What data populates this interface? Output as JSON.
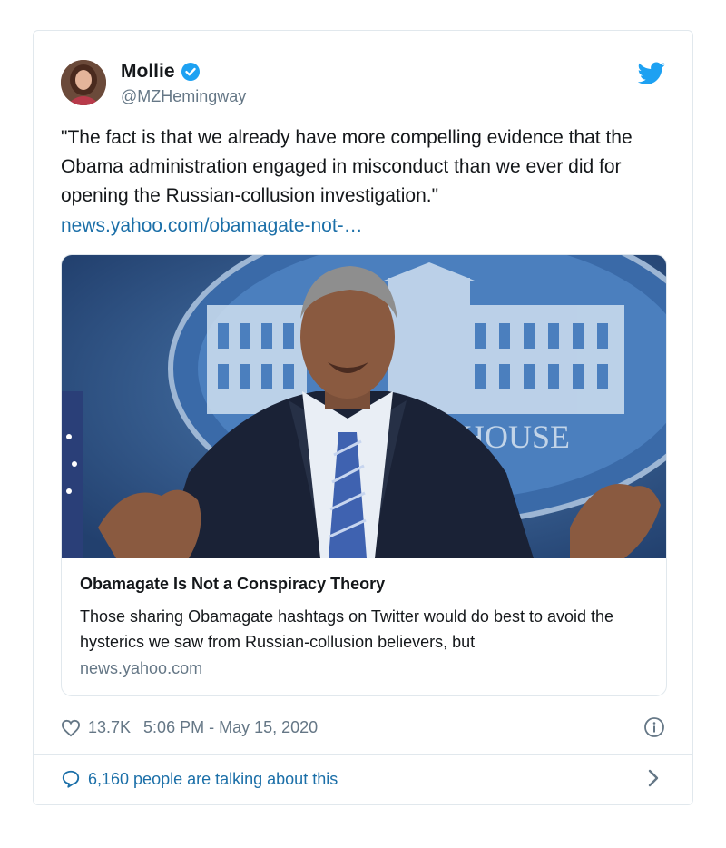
{
  "tweet": {
    "author_name": "Mollie",
    "handle": "@MZHemingway",
    "text": "\"The fact is that we already have more compelling evidence that the Obama administration engaged in misconduct than we ever did for opening the Russian-collusion investigation.\"",
    "link": "news.yahoo.com/obamagate-not-…",
    "likes": "13.7K",
    "timestamp": "5:06 PM - May 15, 2020",
    "conversation": "6,160 people are talking about this"
  },
  "link_card": {
    "title": "Obamagate Is Not a Conspiracy Theory",
    "description": "Those sharing Obamagate hashtags on Twitter would do best to avoid the hysterics we saw from Russian-collusion believers, but",
    "domain": "news.yahoo.com",
    "image_sign_text": "HOUSE"
  },
  "icons": {
    "verified": "verified-badge-icon",
    "brand": "twitter-bird-icon",
    "like": "heart-icon",
    "info": "info-icon",
    "reply": "speech-bubble-icon",
    "chevron": "chevron-right-icon"
  },
  "colors": {
    "accent": "#1da1f2",
    "link": "#1b6fa8",
    "muted": "#657786",
    "border": "#e1e8ed"
  }
}
